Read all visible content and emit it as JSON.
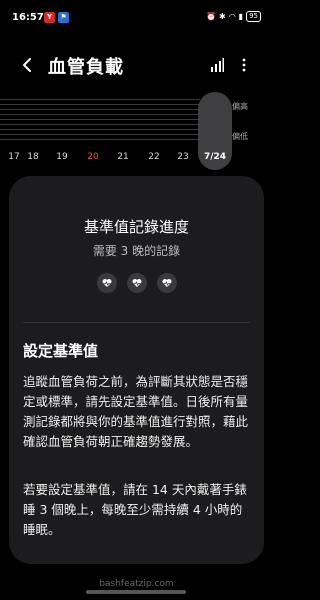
{
  "status": {
    "time": "16:57",
    "notif1": "Y",
    "notif2": "⚑",
    "battery": "95"
  },
  "header": {
    "title": "血管負載",
    "back_icon": "chevron-left-icon",
    "stats_icon": "bar-chart-icon",
    "more_icon": "more-vert-icon"
  },
  "chart": {
    "ref_high": "偏高",
    "ref_low": "偏低",
    "dates": [
      "17",
      "18",
      "19",
      "20",
      "21",
      "22",
      "23",
      "7/24"
    ],
    "today_index": 3,
    "selected_index": 7
  },
  "card": {
    "progress_title": "基準值記錄進度",
    "progress_sub": "需要 3 晚的記錄",
    "section_title": "設定基準值",
    "para1": "追蹤血管負荷之前，為評斷其狀態是否穩定或標準，請先設定基準值。日後所有量測記錄都將與你的基準值進行對照，藉此確認血管負荷朝正確趨勢發展。",
    "para2": "若要設定基準值，請在 14 天內戴著手錶睡 3 個晚上，每晚至少需持續 4 小時的睡眠。"
  },
  "watermark": "bashfeatzip.com"
}
